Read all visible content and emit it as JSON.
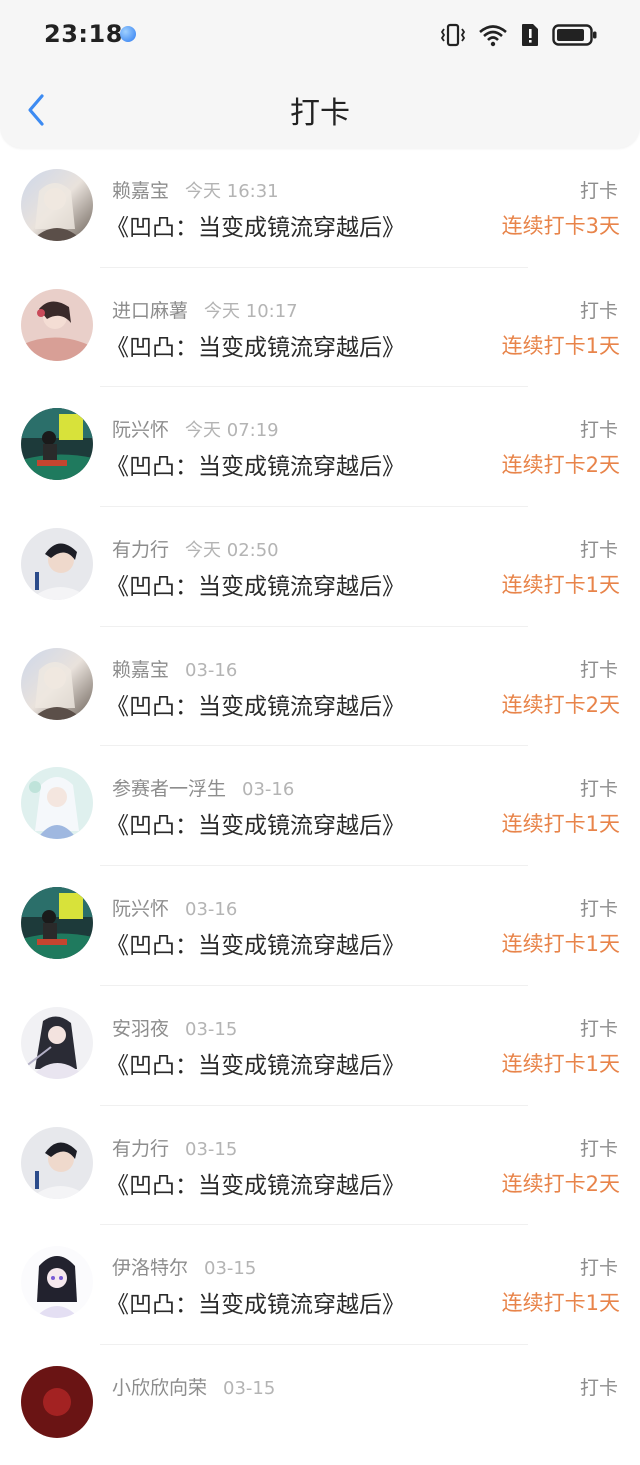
{
  "status_bar": {
    "time": "23:18"
  },
  "nav": {
    "title": "打卡"
  },
  "items": [
    {
      "name": "赖嘉宝",
      "date": "今天 16:31",
      "book": "《凹凸：当变成镜流穿越后》",
      "action": "打卡",
      "streak": "连续打卡3天",
      "avatar": "avatar-a"
    },
    {
      "name": "进口麻薯",
      "date": "今天 10:17",
      "book": "《凹凸：当变成镜流穿越后》",
      "action": "打卡",
      "streak": "连续打卡1天",
      "avatar": "avatar-b"
    },
    {
      "name": "阮兴怀",
      "date": "今天 07:19",
      "book": "《凹凸：当变成镜流穿越后》",
      "action": "打卡",
      "streak": "连续打卡2天",
      "avatar": "avatar-c"
    },
    {
      "name": "有力行",
      "date": "今天 02:50",
      "book": "《凹凸：当变成镜流穿越后》",
      "action": "打卡",
      "streak": "连续打卡1天",
      "avatar": "avatar-d"
    },
    {
      "name": "赖嘉宝",
      "date": "03-16",
      "book": "《凹凸：当变成镜流穿越后》",
      "action": "打卡",
      "streak": "连续打卡2天",
      "avatar": "avatar-a"
    },
    {
      "name": "参赛者一浮生",
      "date": "03-16",
      "book": "《凹凸：当变成镜流穿越后》",
      "action": "打卡",
      "streak": "连续打卡1天",
      "avatar": "avatar-e"
    },
    {
      "name": "阮兴怀",
      "date": "03-16",
      "book": "《凹凸：当变成镜流穿越后》",
      "action": "打卡",
      "streak": "连续打卡1天",
      "avatar": "avatar-c"
    },
    {
      "name": "安羽夜",
      "date": "03-15",
      "book": "《凹凸：当变成镜流穿越后》",
      "action": "打卡",
      "streak": "连续打卡1天",
      "avatar": "avatar-f"
    },
    {
      "name": "有力行",
      "date": "03-15",
      "book": "《凹凸：当变成镜流穿越后》",
      "action": "打卡",
      "streak": "连续打卡2天",
      "avatar": "avatar-d"
    },
    {
      "name": "伊洛特尔",
      "date": "03-15",
      "book": "《凹凸：当变成镜流穿越后》",
      "action": "打卡",
      "streak": "连续打卡1天",
      "avatar": "avatar-g"
    },
    {
      "name": "小欣欣向荣",
      "date": "03-15",
      "book": "",
      "action": "打卡",
      "streak": "",
      "avatar": "avatar-h"
    }
  ]
}
